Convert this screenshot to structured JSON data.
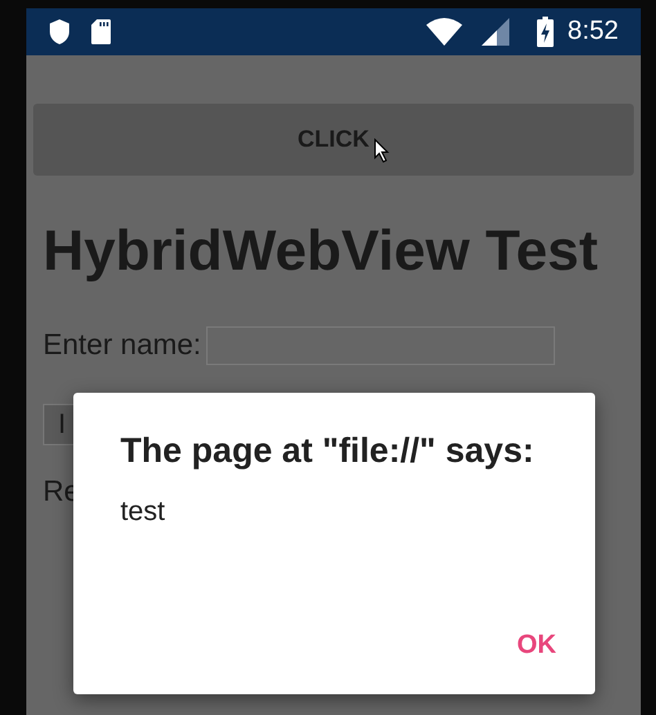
{
  "status_bar": {
    "time": "8:52"
  },
  "click_button": {
    "label": "CLICK"
  },
  "heading": "HybridWebView Test",
  "name_field": {
    "label": "Enter name:"
  },
  "partial_button": {
    "label": "I"
  },
  "result_label": "Re",
  "dialog": {
    "title": "The page at \"file://\" says:",
    "message": "test",
    "buttons": [
      "OK"
    ]
  }
}
